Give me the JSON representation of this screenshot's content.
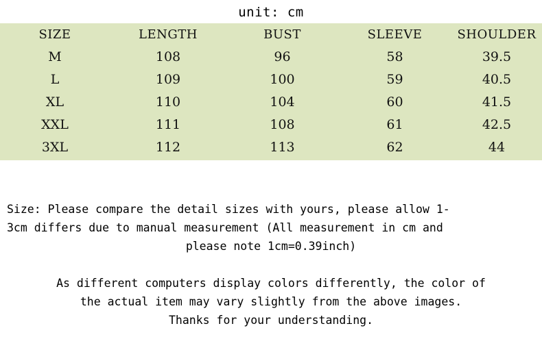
{
  "unit_caption": "unit: cm",
  "colors": {
    "table_background": "#dde6c0",
    "page_background": "#ffffff",
    "text": "#000000"
  },
  "size_table": {
    "columns": [
      "SIZE",
      "LENGTH",
      "BUST",
      "SLEEVE",
      "SHOULDER"
    ],
    "rows": [
      {
        "size": "M",
        "length": "108",
        "bust": "96",
        "sleeve": "58",
        "shoulder": "39.5"
      },
      {
        "size": "L",
        "length": "109",
        "bust": "100",
        "sleeve": "59",
        "shoulder": "40.5"
      },
      {
        "size": "XL",
        "length": "110",
        "bust": "104",
        "sleeve": "60",
        "shoulder": "41.5"
      },
      {
        "size": "XXL",
        "length": "111",
        "bust": "108",
        "sleeve": "61",
        "shoulder": "42.5"
      },
      {
        "size": "3XL",
        "length": "112",
        "bust": "113",
        "sleeve": "62",
        "shoulder": "44"
      }
    ]
  },
  "notes": {
    "size_note": {
      "line1": "Size: Please compare the detail sizes with yours, please allow 1-",
      "line2": "3cm differs due to manual measurement (All measurement in cm and",
      "line3": "please note 1cm=0.39inch)"
    },
    "color_note": {
      "line1": "As different computers display colors differently, the color of",
      "line2": "the actual item may vary slightly from the above images.",
      "line3": "Thanks for your understanding."
    }
  }
}
